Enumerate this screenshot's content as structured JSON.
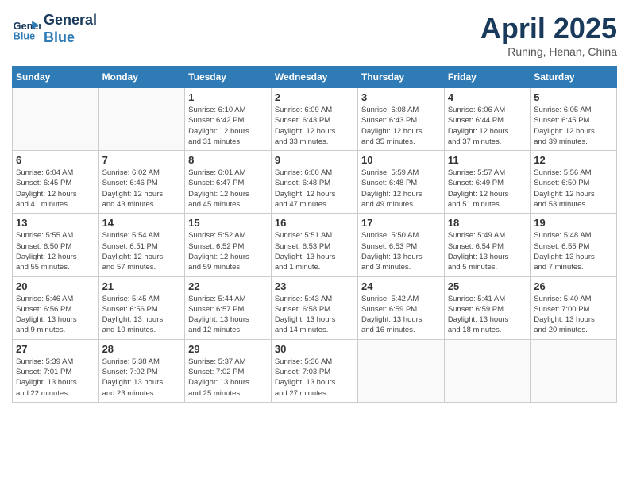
{
  "header": {
    "logo_line1": "General",
    "logo_line2": "Blue",
    "month_title": "April 2025",
    "location": "Runing, Henan, China"
  },
  "weekdays": [
    "Sunday",
    "Monday",
    "Tuesday",
    "Wednesday",
    "Thursday",
    "Friday",
    "Saturday"
  ],
  "weeks": [
    [
      {
        "day": "",
        "info": ""
      },
      {
        "day": "",
        "info": ""
      },
      {
        "day": "1",
        "info": "Sunrise: 6:10 AM\nSunset: 6:42 PM\nDaylight: 12 hours\nand 31 minutes."
      },
      {
        "day": "2",
        "info": "Sunrise: 6:09 AM\nSunset: 6:43 PM\nDaylight: 12 hours\nand 33 minutes."
      },
      {
        "day": "3",
        "info": "Sunrise: 6:08 AM\nSunset: 6:43 PM\nDaylight: 12 hours\nand 35 minutes."
      },
      {
        "day": "4",
        "info": "Sunrise: 6:06 AM\nSunset: 6:44 PM\nDaylight: 12 hours\nand 37 minutes."
      },
      {
        "day": "5",
        "info": "Sunrise: 6:05 AM\nSunset: 6:45 PM\nDaylight: 12 hours\nand 39 minutes."
      }
    ],
    [
      {
        "day": "6",
        "info": "Sunrise: 6:04 AM\nSunset: 6:45 PM\nDaylight: 12 hours\nand 41 minutes."
      },
      {
        "day": "7",
        "info": "Sunrise: 6:02 AM\nSunset: 6:46 PM\nDaylight: 12 hours\nand 43 minutes."
      },
      {
        "day": "8",
        "info": "Sunrise: 6:01 AM\nSunset: 6:47 PM\nDaylight: 12 hours\nand 45 minutes."
      },
      {
        "day": "9",
        "info": "Sunrise: 6:00 AM\nSunset: 6:48 PM\nDaylight: 12 hours\nand 47 minutes."
      },
      {
        "day": "10",
        "info": "Sunrise: 5:59 AM\nSunset: 6:48 PM\nDaylight: 12 hours\nand 49 minutes."
      },
      {
        "day": "11",
        "info": "Sunrise: 5:57 AM\nSunset: 6:49 PM\nDaylight: 12 hours\nand 51 minutes."
      },
      {
        "day": "12",
        "info": "Sunrise: 5:56 AM\nSunset: 6:50 PM\nDaylight: 12 hours\nand 53 minutes."
      }
    ],
    [
      {
        "day": "13",
        "info": "Sunrise: 5:55 AM\nSunset: 6:50 PM\nDaylight: 12 hours\nand 55 minutes."
      },
      {
        "day": "14",
        "info": "Sunrise: 5:54 AM\nSunset: 6:51 PM\nDaylight: 12 hours\nand 57 minutes."
      },
      {
        "day": "15",
        "info": "Sunrise: 5:52 AM\nSunset: 6:52 PM\nDaylight: 12 hours\nand 59 minutes."
      },
      {
        "day": "16",
        "info": "Sunrise: 5:51 AM\nSunset: 6:53 PM\nDaylight: 13 hours\nand 1 minute."
      },
      {
        "day": "17",
        "info": "Sunrise: 5:50 AM\nSunset: 6:53 PM\nDaylight: 13 hours\nand 3 minutes."
      },
      {
        "day": "18",
        "info": "Sunrise: 5:49 AM\nSunset: 6:54 PM\nDaylight: 13 hours\nand 5 minutes."
      },
      {
        "day": "19",
        "info": "Sunrise: 5:48 AM\nSunset: 6:55 PM\nDaylight: 13 hours\nand 7 minutes."
      }
    ],
    [
      {
        "day": "20",
        "info": "Sunrise: 5:46 AM\nSunset: 6:56 PM\nDaylight: 13 hours\nand 9 minutes."
      },
      {
        "day": "21",
        "info": "Sunrise: 5:45 AM\nSunset: 6:56 PM\nDaylight: 13 hours\nand 10 minutes."
      },
      {
        "day": "22",
        "info": "Sunrise: 5:44 AM\nSunset: 6:57 PM\nDaylight: 13 hours\nand 12 minutes."
      },
      {
        "day": "23",
        "info": "Sunrise: 5:43 AM\nSunset: 6:58 PM\nDaylight: 13 hours\nand 14 minutes."
      },
      {
        "day": "24",
        "info": "Sunrise: 5:42 AM\nSunset: 6:59 PM\nDaylight: 13 hours\nand 16 minutes."
      },
      {
        "day": "25",
        "info": "Sunrise: 5:41 AM\nSunset: 6:59 PM\nDaylight: 13 hours\nand 18 minutes."
      },
      {
        "day": "26",
        "info": "Sunrise: 5:40 AM\nSunset: 7:00 PM\nDaylight: 13 hours\nand 20 minutes."
      }
    ],
    [
      {
        "day": "27",
        "info": "Sunrise: 5:39 AM\nSunset: 7:01 PM\nDaylight: 13 hours\nand 22 minutes."
      },
      {
        "day": "28",
        "info": "Sunrise: 5:38 AM\nSunset: 7:02 PM\nDaylight: 13 hours\nand 23 minutes."
      },
      {
        "day": "29",
        "info": "Sunrise: 5:37 AM\nSunset: 7:02 PM\nDaylight: 13 hours\nand 25 minutes."
      },
      {
        "day": "30",
        "info": "Sunrise: 5:36 AM\nSunset: 7:03 PM\nDaylight: 13 hours\nand 27 minutes."
      },
      {
        "day": "",
        "info": ""
      },
      {
        "day": "",
        "info": ""
      },
      {
        "day": "",
        "info": ""
      }
    ]
  ]
}
